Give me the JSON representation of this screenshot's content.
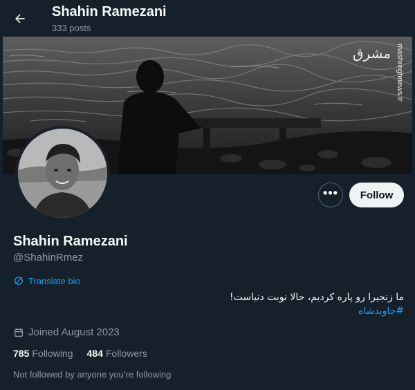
{
  "header": {
    "name": "Shahin Ramezani",
    "posts": "333 posts"
  },
  "watermark": {
    "logo": "مشرق",
    "site": "mashreghnews.ir"
  },
  "actions": {
    "more_label": "•••",
    "follow_label": "Follow"
  },
  "profile": {
    "name": "Shahin Ramezani",
    "handle": "@ShahinRmez",
    "translate_label": "Translate bio",
    "bio_line": "ما زنجیرا رو پاره کردیم، حالا نوبت دنیاست!",
    "bio_hashtag": "#جاویدشاه",
    "joined": "Joined August 2023",
    "following_count": "785",
    "following_label": "Following",
    "followers_count": "484",
    "followers_label": "Followers",
    "not_followed": "Not followed by anyone you’re following"
  },
  "colors": {
    "background": "#15202b",
    "accent": "#1d9bf0",
    "muted": "#8b98a5"
  }
}
